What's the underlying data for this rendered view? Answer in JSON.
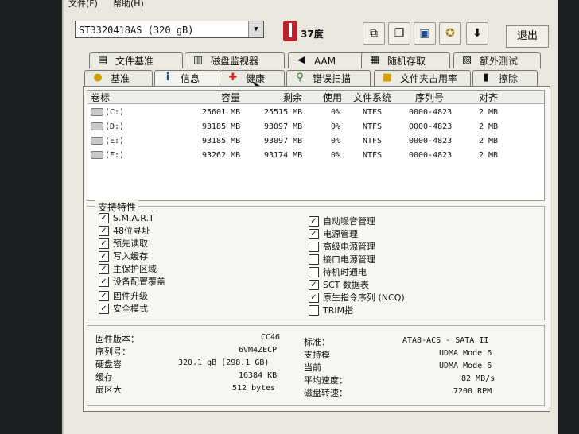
{
  "menu": [
    "文件(F)",
    "帮助(H)"
  ],
  "drive_select": {
    "value": "ST3320418AS (320 gB)"
  },
  "temperature": "37度",
  "toolbar_icons": [
    "copy-icon",
    "copy-all-icon",
    "save-icon",
    "options-icon",
    "down-arrow-icon"
  ],
  "exit_label": "退出",
  "tabs_row1": [
    {
      "label": "文件基准",
      "icon": "file-benchmark-icon"
    },
    {
      "label": "磁盘监视器",
      "icon": "disk-monitor-icon"
    },
    {
      "label": "AAM",
      "icon": "speaker-icon"
    },
    {
      "label": "随机存取",
      "icon": "random-access-icon"
    },
    {
      "label": "额外测试",
      "icon": "extra-tests-icon"
    }
  ],
  "tabs_row2": [
    {
      "label": "基准",
      "icon": "benchmark-icon"
    },
    {
      "label": "信息",
      "icon": "info-icon"
    },
    {
      "label": "健康",
      "icon": "health-cross-icon"
    },
    {
      "label": "错误扫描",
      "icon": "error-scan-icon"
    },
    {
      "label": "文件夹占用率",
      "icon": "folder-icon"
    },
    {
      "label": "擦除",
      "icon": "erase-icon"
    }
  ],
  "volumes": {
    "headers": [
      "卷标",
      "容量",
      "剩余",
      "使用",
      "文件系统",
      "序列号",
      "对齐"
    ],
    "rows": [
      {
        "label": "(C:)",
        "capacity": "25601 MB",
        "free": "25515 MB",
        "used": "0%",
        "fs": "NTFS",
        "serial": "0000-4823",
        "align": "2 MB"
      },
      {
        "label": "(D:)",
        "capacity": "93185 MB",
        "free": "93097 MB",
        "used": "0%",
        "fs": "NTFS",
        "serial": "0000-4823",
        "align": "2 MB"
      },
      {
        "label": "(E:)",
        "capacity": "93185 MB",
        "free": "93097 MB",
        "used": "0%",
        "fs": "NTFS",
        "serial": "0000-4823",
        "align": "2 MB"
      },
      {
        "label": "(F:)",
        "capacity": "93262 MB",
        "free": "93174 MB",
        "used": "0%",
        "fs": "NTFS",
        "serial": "0000-4823",
        "align": "2 MB"
      }
    ]
  },
  "features": {
    "title": "支持特性",
    "left": [
      {
        "label": "S.M.A.R.T",
        "checked": true
      },
      {
        "label": "48位寻址",
        "checked": true
      },
      {
        "label": "预先读取",
        "checked": true
      },
      {
        "label": "写入缓存",
        "checked": true
      },
      {
        "label": "主保护区域",
        "checked": true
      },
      {
        "label": "设备配置覆盖",
        "checked": true
      },
      {
        "label": "固件升级",
        "checked": true
      },
      {
        "label": "安全模式",
        "checked": true
      }
    ],
    "right": [
      {
        "label": "自动噪音管理",
        "checked": true
      },
      {
        "label": "电源管理",
        "checked": true
      },
      {
        "label": "高级电源管理",
        "checked": false
      },
      {
        "label": "接口电源管理",
        "checked": false
      },
      {
        "label": "待机时通电",
        "checked": false
      },
      {
        "label": "SCT 数据表",
        "checked": true
      },
      {
        "label": "原生指令序列 (NCQ)",
        "checked": true
      },
      {
        "label": "TRIM指",
        "checked": false
      }
    ]
  },
  "info": {
    "firmware_label": "固件版本：",
    "firmware": "CC46",
    "serial_label": "序列号：",
    "serial": "6VM4ZECP",
    "capacity_label": "硬盘容",
    "capacity": "320.1 gB (298.1 GB)",
    "cache_label": "缓存",
    "cache": "16384 KB",
    "sector_label": "扇区大",
    "sector": "512 bytes",
    "standard_label": "标准：",
    "standard": "ATA8-ACS - SATA II",
    "supported_label": "支持模",
    "supported": "UDMA Mode 6",
    "current_label": "当前",
    "current": "UDMA Mode 6",
    "avg_speed_label": "平均速度：",
    "avg_speed": "82 MB/s",
    "rpm_label": "磁盘转速：",
    "rpm": "7200 RPM"
  }
}
